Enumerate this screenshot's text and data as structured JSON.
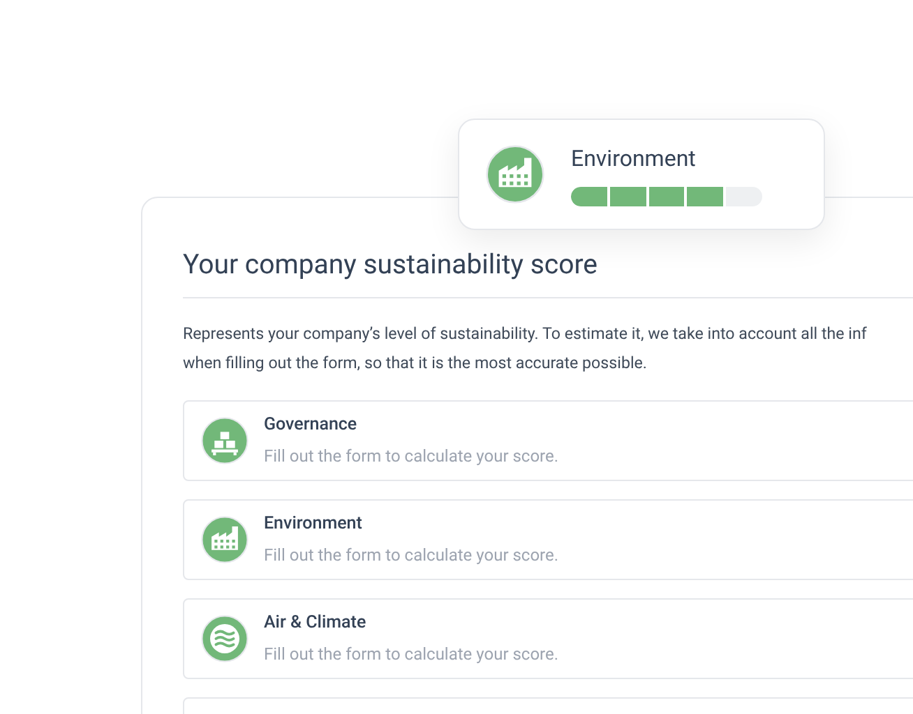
{
  "score_card": {
    "title": "Your company sustainability score",
    "description_lines": [
      "Represents your company’s level of sustainability. To estimate it, we take into account all the inf",
      "when filling out the form, so that it is the most accurate possible."
    ],
    "categories": [
      {
        "kind": "governance",
        "name": "Governance",
        "hint": "Fill out the form to calculate your score."
      },
      {
        "kind": "environment",
        "name": "Environment",
        "hint": "Fill out the form to calculate your score."
      },
      {
        "kind": "air",
        "name": "Air & Climate",
        "hint": "Fill out the form to calculate your score."
      }
    ]
  },
  "popup": {
    "kind": "environment",
    "name": "Environment",
    "level": 0.8
  }
}
